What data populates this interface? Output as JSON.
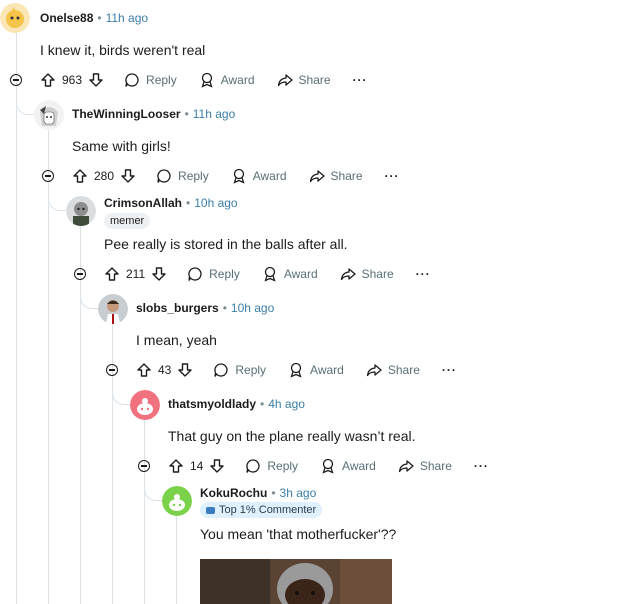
{
  "comments": [
    {
      "username": "Onelse88",
      "time": "11h ago",
      "text": "I knew it, birds weren't real",
      "votes": "963"
    },
    {
      "username": "TheWinningLooser",
      "time": "11h ago",
      "text": "Same with girls!",
      "votes": "280"
    },
    {
      "username": "CrimsonAllah",
      "time": "10h ago",
      "flair": "memer",
      "text": "Pee really is stored in the balls after all.",
      "votes": "211"
    },
    {
      "username": "slobs_burgers",
      "time": "10h ago",
      "text": "I mean, yeah",
      "votes": "43"
    },
    {
      "username": "thatsmyoldlady",
      "time": "4h ago",
      "text": "That guy on the plane really wasn’t real.",
      "votes": "14"
    },
    {
      "username": "KokuRochu",
      "time": "3h ago",
      "flair": "Top 1% Commenter",
      "text": "You mean 'that motherfucker'??"
    }
  ],
  "actions": {
    "reply": "Reply",
    "award": "Award",
    "share": "Share",
    "more": "···"
  },
  "separator": "•",
  "colors": {
    "time": "#3b7fa6",
    "thread": "#dbe3e8",
    "avatar_pink": "#f1727f",
    "avatar_green": "#7ad14a"
  }
}
